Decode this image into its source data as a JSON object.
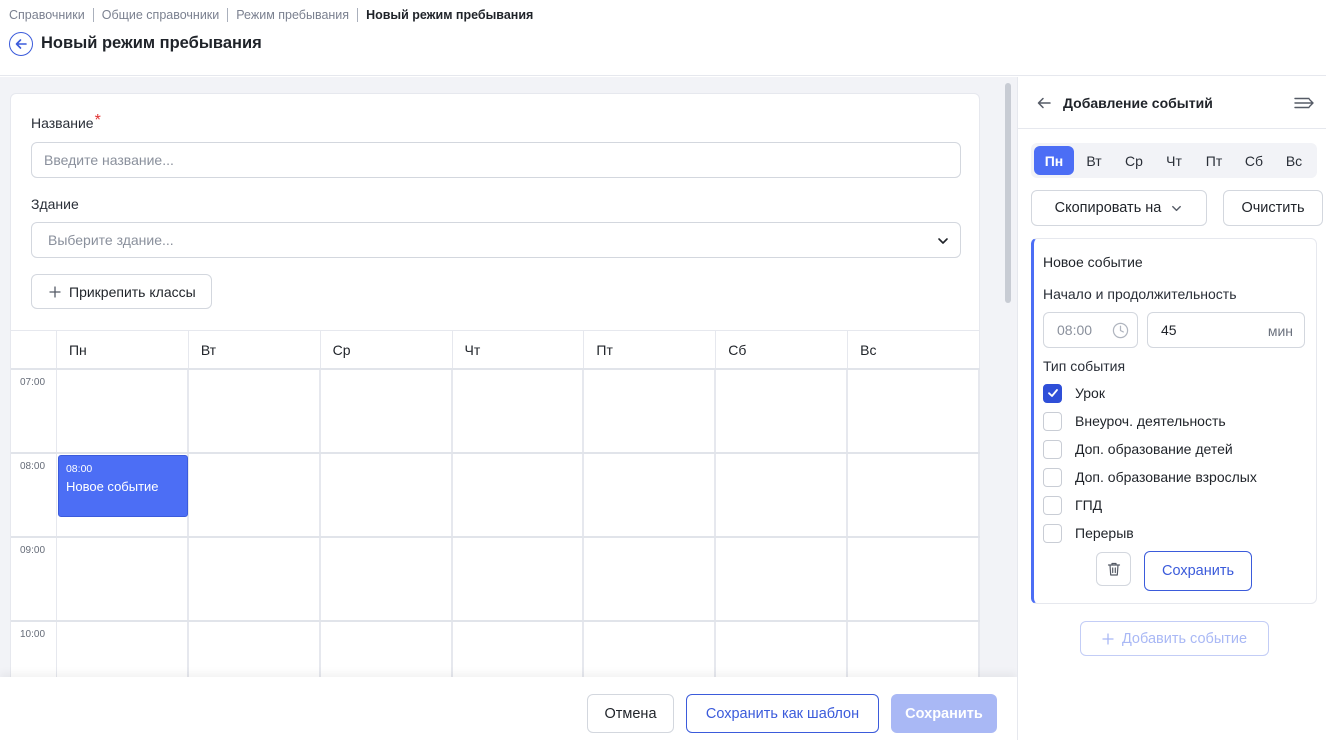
{
  "breadcrumb": {
    "items": [
      "Справочники",
      "Общие справочники",
      "Режим пребывания"
    ],
    "current": "Новый режим пребывания"
  },
  "page": {
    "title": "Новый режим пребывания"
  },
  "form": {
    "name_label": "Название",
    "required_mark": "*",
    "name_placeholder": "Введите название...",
    "building_label": "Здание",
    "building_placeholder": "Выберите здание...",
    "attach_label": "Прикрепить классы"
  },
  "calendar": {
    "days": [
      "Пн",
      "Вт",
      "Ср",
      "Чт",
      "Пт",
      "Сб",
      "Вс"
    ],
    "times": [
      "07:00",
      "08:00",
      "09:00",
      "10:00"
    ],
    "event": {
      "time": "08:00",
      "title": "Новое событие"
    }
  },
  "footer": {
    "cancel": "Отмена",
    "save_template": "Сохранить как шаблон",
    "save": "Сохранить"
  },
  "panel": {
    "title": "Добавление событий",
    "days": [
      "Пн",
      "Вт",
      "Ср",
      "Чт",
      "Пт",
      "Сб",
      "Вс"
    ],
    "active_day": "Пн",
    "copy_label": "Скопировать на",
    "clear_label": "Очистить",
    "event_card": {
      "title": "Новое событие",
      "start_duration_label": "Начало и продолжительность",
      "start_time": "08:00",
      "duration_value": "45",
      "duration_unit": "мин",
      "type_label": "Тип события",
      "types": [
        {
          "label": "Урок",
          "checked": true
        },
        {
          "label": "Внеуроч. деятельность",
          "checked": false
        },
        {
          "label": "Доп. образование детей",
          "checked": false
        },
        {
          "label": "Доп. образование взрослых",
          "checked": false
        },
        {
          "label": "ГПД",
          "checked": false
        },
        {
          "label": "Перерыв",
          "checked": false
        }
      ],
      "save_label": "Сохранить"
    },
    "add_event_label": "Добавить событие"
  },
  "colors": {
    "accent": "#4c6ef5",
    "accent_dark": "#3b5bdb",
    "disabled": "#a9b8f5",
    "required": "#e03131"
  }
}
